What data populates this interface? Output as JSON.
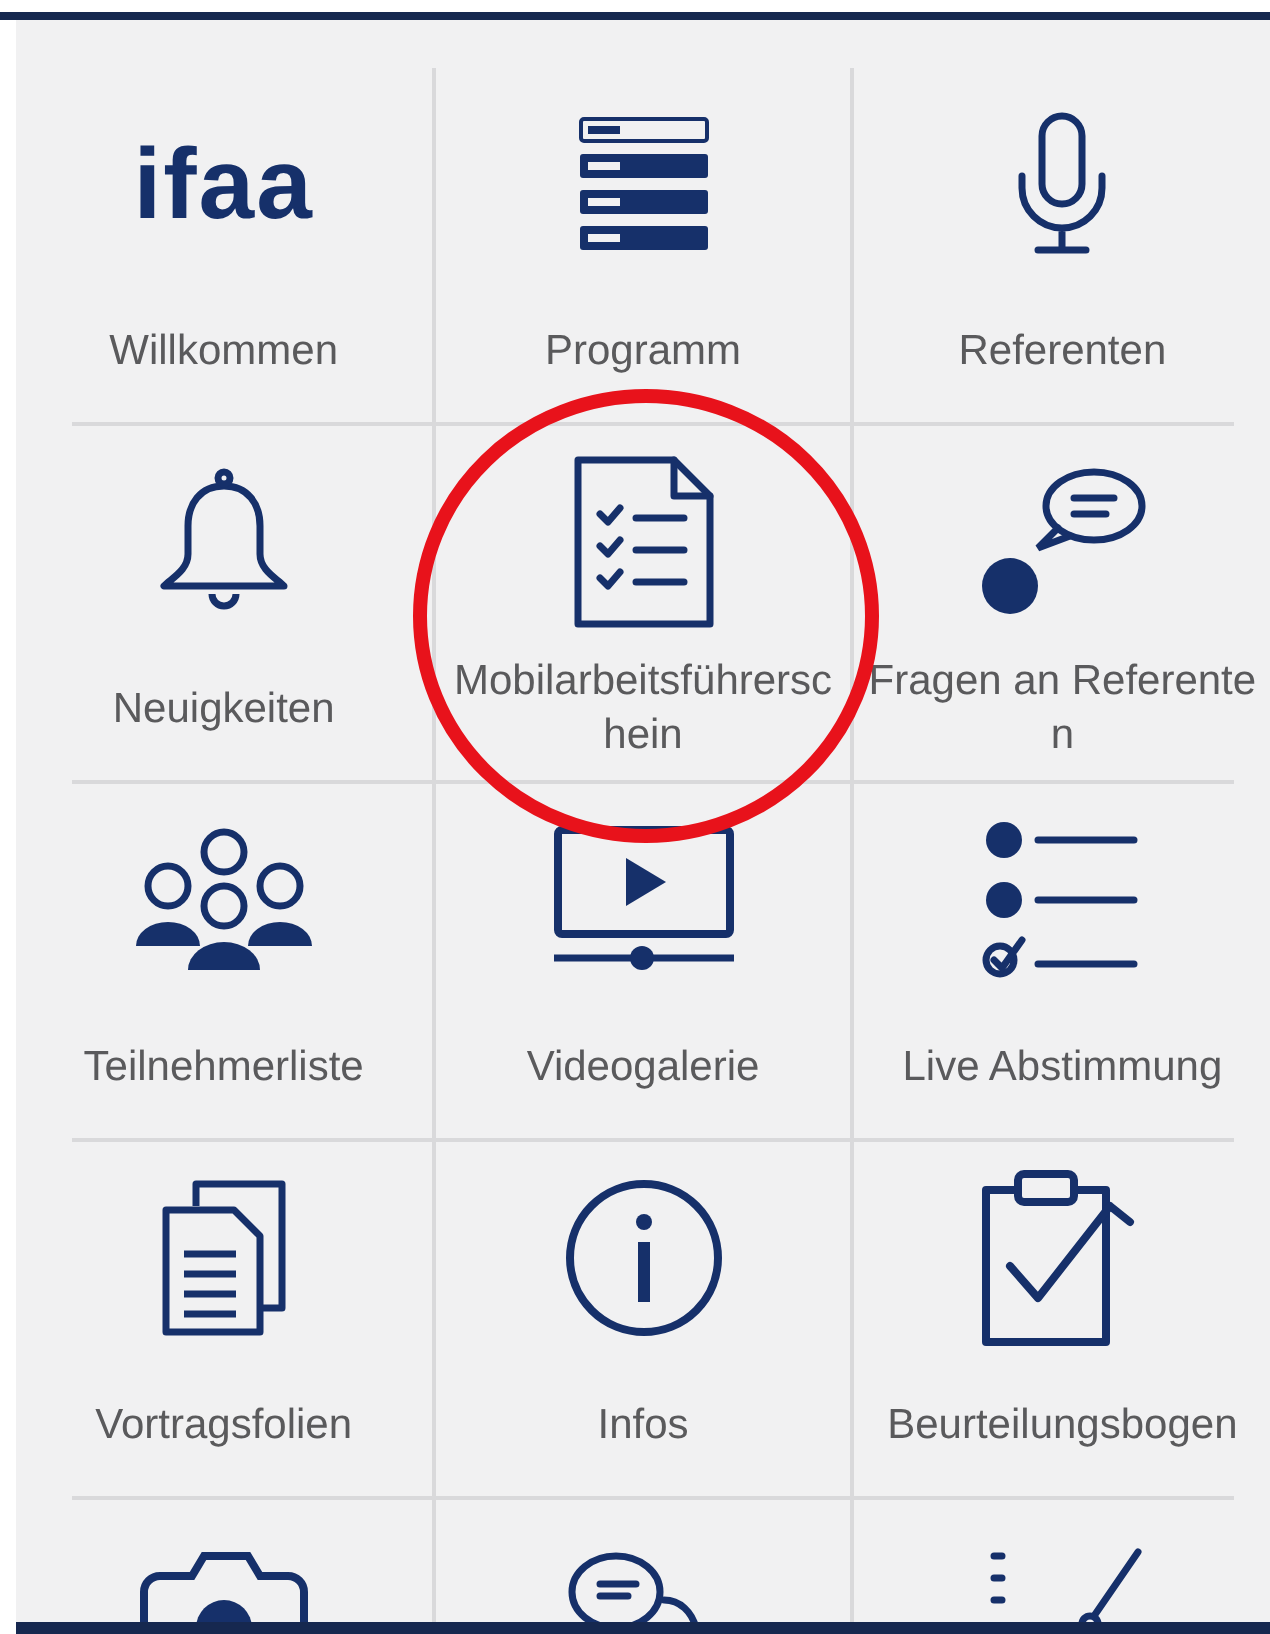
{
  "tiles": [
    {
      "kind": "logo",
      "logo": "ifaa",
      "label": "Willkommen"
    },
    {
      "kind": "program",
      "label": "Programm"
    },
    {
      "kind": "mic",
      "label": "Referenten"
    },
    {
      "kind": "bell",
      "label": "Neuigkeiten"
    },
    {
      "kind": "document",
      "label": "Mobilarbeitsführerschein"
    },
    {
      "kind": "question",
      "label": "Fragen an Referenten"
    },
    {
      "kind": "people",
      "label": "Teilnehmerliste"
    },
    {
      "kind": "video",
      "label": "Videogalerie"
    },
    {
      "kind": "poll",
      "label": "Live Abstimmung"
    },
    {
      "kind": "slides",
      "label": "Vortragsfolien"
    },
    {
      "kind": "info",
      "label": "Infos"
    },
    {
      "kind": "clipboard",
      "label": "Beurteilungsbogen"
    },
    {
      "kind": "camera"
    },
    {
      "kind": "chat"
    },
    {
      "kind": "checklist"
    }
  ]
}
